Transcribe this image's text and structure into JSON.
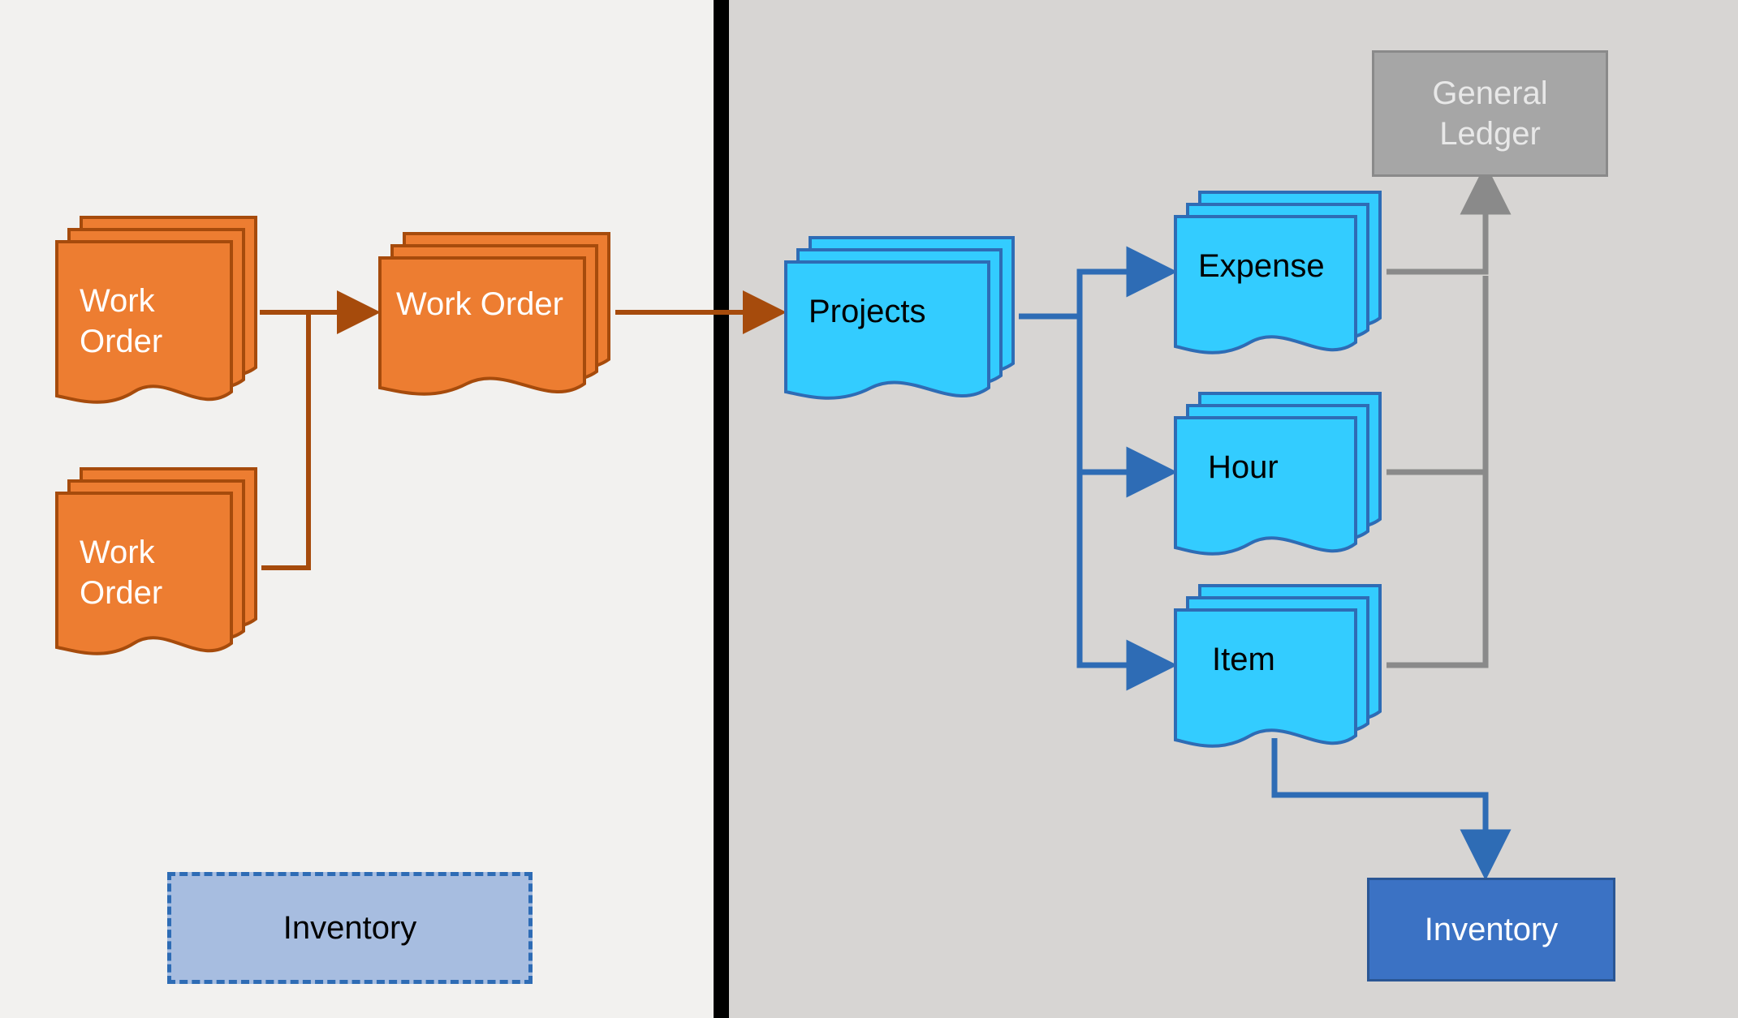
{
  "colors": {
    "orange_fill": "#ed7d31",
    "orange_stroke": "#a64b0c",
    "cyan_fill": "#33ccff",
    "blue_stroke": "#2e6cb5",
    "gray_box": "#a6a6a6",
    "gray_stroke": "#8a8a8a",
    "blue_box": "#3b72c4",
    "blue_box_stroke": "#2a5694",
    "dashed_fill": "#a7bde0",
    "dashed_stroke": "#2e6cb5"
  },
  "left": {
    "work_order_stack_1": "Work\nOrder",
    "work_order_stack_2": "Work\nOrder",
    "work_order_center": "Work Order",
    "inventory_dashed": "Inventory"
  },
  "right": {
    "projects": "Projects",
    "expense": "Expense",
    "hour": "Hour",
    "item": "Item",
    "general_ledger": "General\nLedger",
    "inventory": "Inventory"
  }
}
